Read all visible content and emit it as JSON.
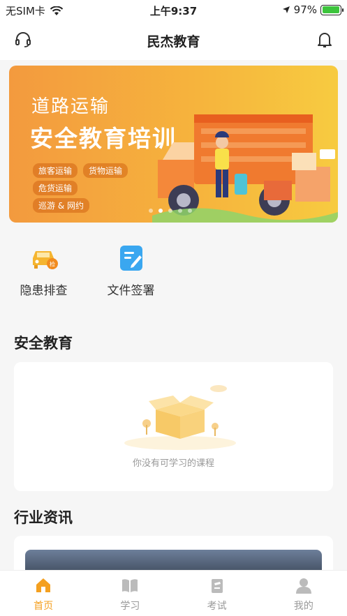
{
  "status_bar": {
    "carrier": "无SIM卡",
    "time": "上午9:37",
    "battery": "97%",
    "battery_level": 0.97
  },
  "header": {
    "title": "民杰教育"
  },
  "banner": {
    "subtitle": "道路运输",
    "title": "安全教育培训",
    "tags": [
      "旅客运输",
      "货物运输",
      "危货运输",
      "巡游 & 网约"
    ],
    "slide_count": 5,
    "active_slide": 1
  },
  "shortcuts": [
    {
      "label": "隐患排查",
      "icon": "car-inspection-icon"
    },
    {
      "label": "文件签署",
      "icon": "document-sign-icon"
    }
  ],
  "safety_section": {
    "title": "安全教育",
    "empty_text": "你没有可学习的课程"
  },
  "news_section": {
    "title": "行业资讯"
  },
  "tabs": [
    {
      "label": "首页",
      "icon": "home-icon",
      "active": true
    },
    {
      "label": "学习",
      "icon": "book-icon",
      "active": false
    },
    {
      "label": "考试",
      "icon": "exam-icon",
      "active": false
    },
    {
      "label": "我的",
      "icon": "user-icon",
      "active": false
    }
  ],
  "colors": {
    "accent": "#f4a020",
    "banner_start": "#f39a3e",
    "banner_end": "#f7cb40"
  }
}
